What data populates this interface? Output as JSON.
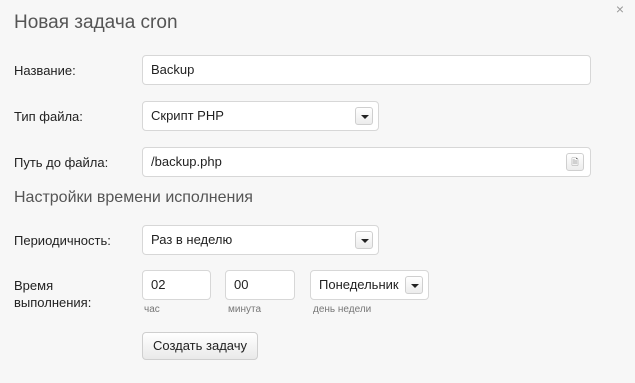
{
  "dialog": {
    "title": "Новая задача cron",
    "close_icon": "×"
  },
  "fields": {
    "name": {
      "label": "Название:",
      "value": "Backup"
    },
    "file_type": {
      "label": "Тип файла:",
      "value": "Скрипт PHP"
    },
    "file_path": {
      "label": "Путь до файла:",
      "value": "/backup.php",
      "browse_icon": "file-browse-icon",
      "browse_glyph": "🗎"
    }
  },
  "schedule": {
    "section_title": "Настройки времени исполнения",
    "period": {
      "label": "Периодичность:",
      "value": "Раз в неделю"
    },
    "time": {
      "label_line1": "Время",
      "label_line2": "выполнения:",
      "hour": {
        "value": "02",
        "hint": "час"
      },
      "minute": {
        "value": "00",
        "hint": "минута"
      },
      "weekday": {
        "value": "Понедельник",
        "hint": "день недели"
      }
    }
  },
  "submit_label": "Создать задачу"
}
